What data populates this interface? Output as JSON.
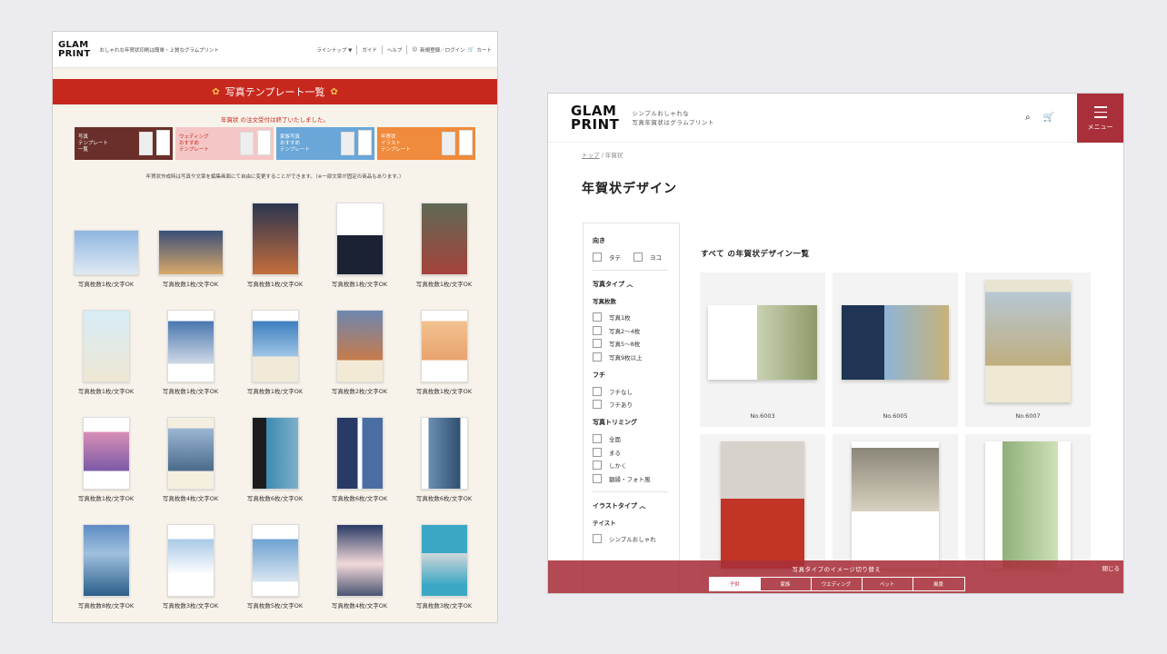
{
  "left": {
    "logo": [
      "GLAM",
      "PRINT"
    ],
    "tagline": "おしゃれな年賀状印刷は簡単・上質なグラムプリント",
    "nav": [
      "ラインナップ ▼",
      "ガイド",
      "ヘルプ",
      "新規登録／ログイン",
      "カート"
    ],
    "banner_title": "写真テンプレート一覧",
    "notice": "年賀状 の注文受付は終了いたしました。",
    "categories": [
      {
        "label": "写真\nテンプレート\n一覧"
      },
      {
        "label": "ウェディング\nおすすめ\nテンプレート"
      },
      {
        "label": "家族写真\nおすすめ\nテンプレート"
      },
      {
        "label": "年賀状\nイラスト\nテンプレート"
      }
    ],
    "sub_note": "年賀状作成時は写真や文章を編集画面にて自由に変更することができます。（※一部文章が固定の商品もあります。）",
    "templates": [
      "写真枚数1枚/文字OK",
      "写真枚数1枚/文字OK",
      "写真枚数1枚/文字OK",
      "写真枚数1枚/文字OK",
      "写真枚数1枚/文字OK",
      "写真枚数1枚/文字OK",
      "写真枚数1枚/文字OK",
      "写真枚数1枚/文字OK",
      "写真枚数2枚/文字OK",
      "写真枚数1枚/文字OK",
      "写真枚数1枚/文字OK",
      "写真枚数4枚/文字OK",
      "写真枚数6枚/文字OK",
      "写真枚数6枚/文字OK",
      "写真枚数6枚/文字OK",
      "写真枚数8枚/文字OK",
      "写真枚数3枚/文字OK",
      "写真枚数5枚/文字OK",
      "写真枚数4枚/文字OK",
      "写真枚数3枚/文字OK"
    ]
  },
  "right": {
    "logo": [
      "GLAM",
      "PRINT"
    ],
    "tagline": [
      "シンプルおしゃれな",
      "写真年賀状はグラムプリント"
    ],
    "menu_label": "メニュー",
    "breadcrumb": [
      "トップ",
      "年賀状"
    ],
    "page_title": "年賀状デザイン",
    "filters": {
      "orientation": {
        "title": "向き",
        "options": [
          "タテ",
          "ヨコ"
        ]
      },
      "photo_type": {
        "title": "写真タイプ",
        "count_title": "写真枚数",
        "counts": [
          "写真1枚",
          "写真2～4枚",
          "写真5～8枚",
          "写真9枚以上"
        ]
      },
      "frame": {
        "title": "フチ",
        "options": [
          "フチなし",
          "フチあり"
        ]
      },
      "trimming": {
        "title": "写真トリミング",
        "options": [
          "全面",
          "まる",
          "しかく",
          "額縁・フォト風"
        ]
      },
      "illust_type": {
        "title": "イラストタイプ",
        "taste_title": "テイスト",
        "options": [
          "シンプルおしゃれ"
        ]
      }
    },
    "list_title": "すべて の年賀状デザイン一覧",
    "cards": [
      "No.6003",
      "No.6005",
      "No.6007",
      "",
      "",
      ""
    ],
    "bottom_bar": {
      "title": "写真タイプのイメージ切り替え",
      "close": "閉じる",
      "tabs": [
        "子供",
        "家族",
        "ウエディング",
        "ペット",
        "風景"
      ],
      "active_tab": 0
    }
  }
}
